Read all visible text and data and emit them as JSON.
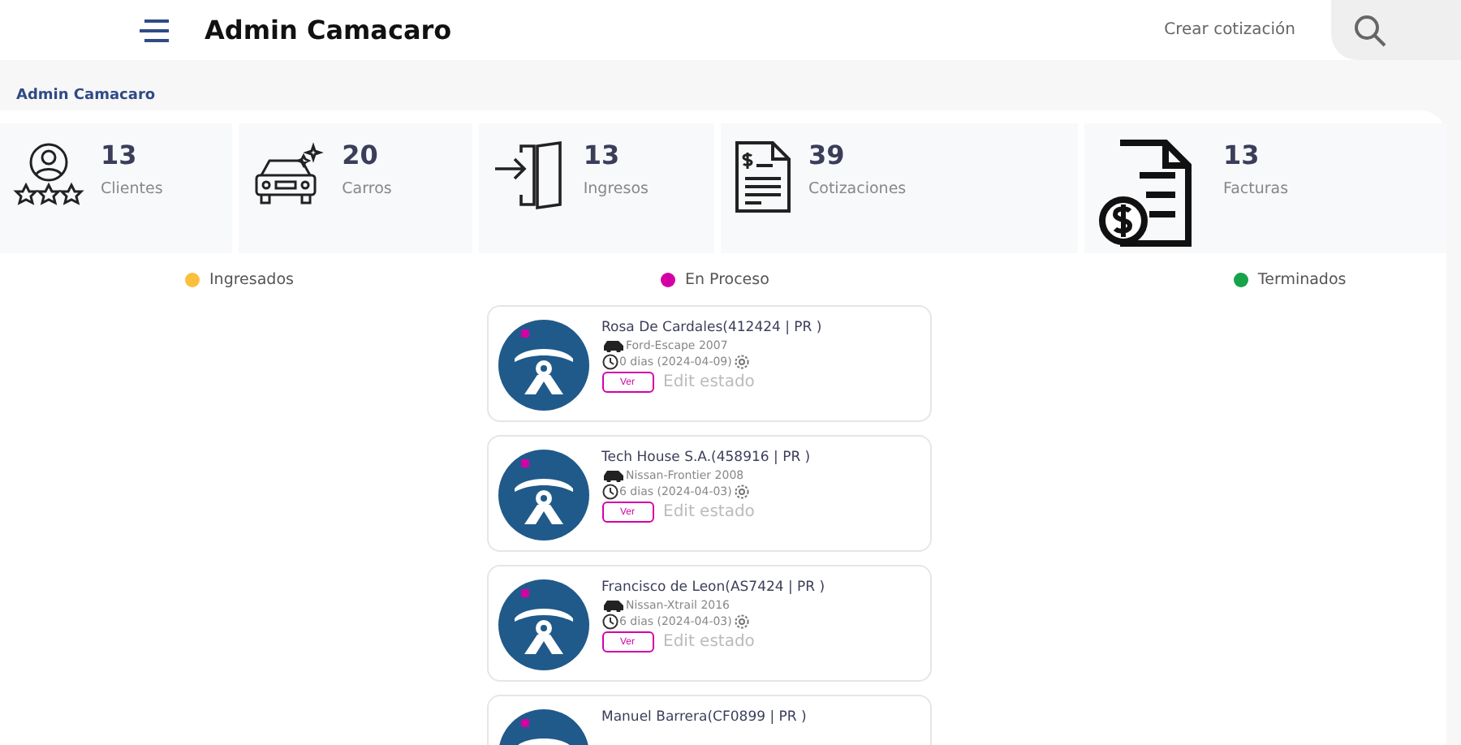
{
  "header": {
    "title": "Admin Camacaro",
    "create_link": "Crear cotización"
  },
  "breadcrumb": "Admin Camacaro",
  "stats": [
    {
      "kind": "clients",
      "value": "13",
      "label": "Clientes"
    },
    {
      "kind": "cars",
      "value": "20",
      "label": "Carros"
    },
    {
      "kind": "entries",
      "value": "13",
      "label": "Ingresos"
    },
    {
      "kind": "quotes",
      "value": "39",
      "label": "Cotizaciones"
    },
    {
      "kind": "invoices",
      "value": "13",
      "label": "Facturas"
    }
  ],
  "legend": [
    {
      "label": "Ingresados",
      "color": "#fbbf3c"
    },
    {
      "label": "En Proceso",
      "color": "#d400a6"
    },
    {
      "label": "Terminados",
      "color": "#16a34a"
    }
  ],
  "orders": [
    {
      "title": "Rosa De Cardales(412424 | PR )",
      "vehicle": "Ford-Escape 2007",
      "age": "0 dias (2024-04-09)",
      "view": "Ver",
      "edit": "Edit estado",
      "color": "#d400a6"
    },
    {
      "title": "Tech House S.A.(458916 | PR )",
      "vehicle": "Nissan-Frontier 2008",
      "age": "6 dias (2024-04-03)",
      "view": "Ver",
      "edit": "Edit estado",
      "color": "#d400a6"
    },
    {
      "title": "Francisco de Leon(AS7424 | PR )",
      "vehicle": "Nissan-Xtrail 2016",
      "age": "6 dias (2024-04-03)",
      "view": "Ver",
      "edit": "Edit estado",
      "color": "#d400a6"
    },
    {
      "title": "Manuel Barrera(CF0899 | PR )",
      "color": "#d400a6"
    }
  ]
}
